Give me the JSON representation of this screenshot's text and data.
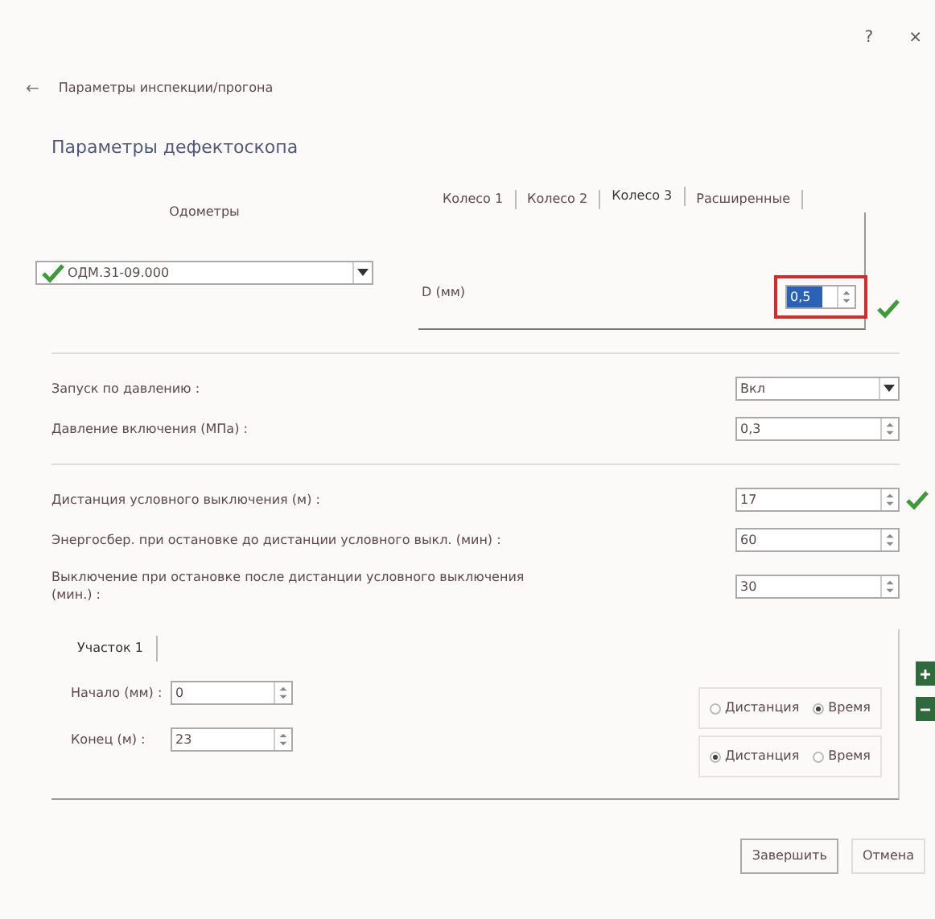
{
  "window": {
    "help": "?",
    "close": "×"
  },
  "breadcrumb": {
    "back": "←",
    "text": "Параметры инспекции/прогона"
  },
  "title": "Параметры дефектоскопа",
  "odometers": {
    "label": "Одометры",
    "value": "ОДМ.31-09.000",
    "valid": true
  },
  "wheel_tabs": [
    {
      "label": "Колесо 1",
      "selected": false
    },
    {
      "label": "Колесо 2",
      "selected": false
    },
    {
      "label": "Колесо 3",
      "selected": true
    },
    {
      "label": "Расширенные",
      "selected": false
    }
  ],
  "wheel_param": {
    "label": "D (мм)",
    "value": "0,5",
    "highlighted": true,
    "valid": true
  },
  "pressure": [
    {
      "kind": "select",
      "label": "Запуск по давлению :",
      "value": "Вкл"
    },
    {
      "kind": "spin",
      "label": "Давление включения (МПа) :",
      "value": "0,3"
    }
  ],
  "shutdown": [
    {
      "kind": "spin",
      "label": "Дистанция условного выключения (м) :",
      "value": "17",
      "valid": true
    },
    {
      "kind": "spin",
      "label": "Энергосбер. при остановке до дистанции условного выкл. (мин) :",
      "value": "60"
    },
    {
      "kind": "spin",
      "label": "Выключение при остановке после дистанции условного выключения (мин.) :",
      "value": "30"
    }
  ],
  "section_tabs": [
    {
      "label": "Участок 1",
      "selected": true
    }
  ],
  "section_fields": [
    {
      "label": "Начало (мм) :",
      "value": "0"
    },
    {
      "label": "Конец (м) :",
      "value": "23"
    }
  ],
  "mode_groups": [
    {
      "options": [
        {
          "label": "Дистанция",
          "selected": false
        },
        {
          "label": "Время",
          "selected": true
        }
      ]
    },
    {
      "options": [
        {
          "label": "Дистанция",
          "selected": true
        },
        {
          "label": "Время",
          "selected": false
        }
      ]
    }
  ],
  "section_buttons": [
    {
      "kind": "add"
    },
    {
      "kind": "remove"
    }
  ],
  "buttons": [
    {
      "label": "Завершить",
      "default": true
    },
    {
      "label": "Отмена",
      "default": false
    }
  ]
}
